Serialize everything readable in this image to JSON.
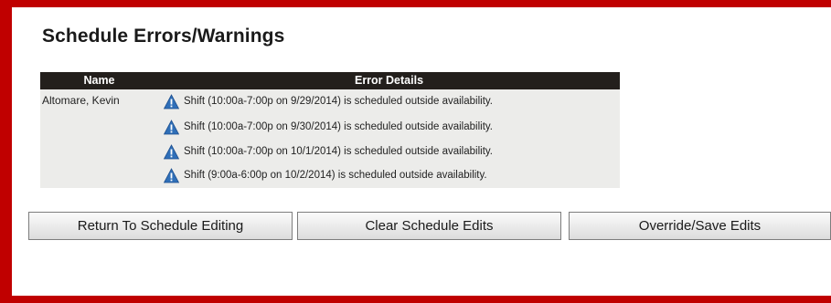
{
  "page": {
    "title": "Schedule Errors/Warnings"
  },
  "grid": {
    "columns": {
      "name": "Name",
      "details": "Error Details"
    },
    "rows": [
      {
        "name": "Altomare, Kevin",
        "errors": [
          "Shift (10:00a-7:00p on 9/29/2014) is scheduled outside availability.",
          "Shift (10:00a-7:00p on 9/30/2014) is scheduled outside availability.",
          "Shift (10:00a-7:00p on 10/1/2014) is scheduled outside availability.",
          "Shift (9:00a-6:00p on 10/2/2014) is scheduled outside availability."
        ]
      }
    ]
  },
  "buttons": {
    "return": "Return To Schedule Editing",
    "clear": "Clear Schedule Edits",
    "override": "Override/Save Edits"
  },
  "icons": {
    "warning": "warning-triangle-icon"
  },
  "colors": {
    "frame": "#c00000",
    "header_bg": "#231f1c",
    "grid_bg": "#ececea",
    "warning_icon": "#2f6fb8"
  }
}
